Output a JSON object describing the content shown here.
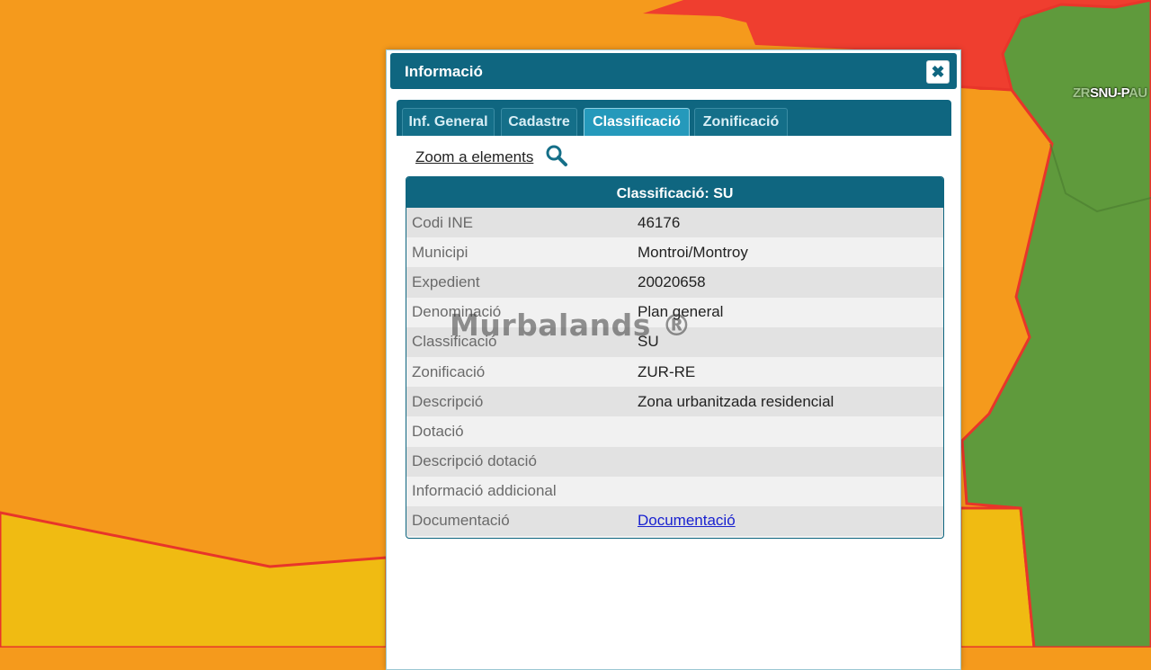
{
  "map": {
    "zone_label_dim": "ZR",
    "zone_label": "SNU-P",
    "zone_label_tail": "AU",
    "colors": {
      "orange": "#f59a1c",
      "red": "#ef3e2f",
      "yellow": "#f0bb12",
      "green": "#5f9a3c",
      "border": "#e8352a"
    }
  },
  "dialog": {
    "title": "Informació",
    "close_glyph": "✖",
    "tabs": [
      {
        "label": "Inf. General",
        "active": false
      },
      {
        "label": "Cadastre",
        "active": false
      },
      {
        "label": "Classificació",
        "active": true
      },
      {
        "label": "Zonificació",
        "active": false
      }
    ],
    "zoom_link": "Zoom a elements",
    "zoom_icon": "search-icon",
    "table": {
      "title_prefix": "Classificació: ",
      "title_value": "SU",
      "rows": [
        {
          "label": "Codi INE",
          "value": "46176"
        },
        {
          "label": "Municipi",
          "value": "Montroi/Montroy"
        },
        {
          "label": "Expedient",
          "value": "20020658"
        },
        {
          "label": "Denominació",
          "value": "Plan general"
        },
        {
          "label": "Classificació",
          "value": "SU"
        },
        {
          "label": "Zonificació",
          "value": "ZUR-RE"
        },
        {
          "label": "Descripció",
          "value": "Zona urbanitzada residencial"
        },
        {
          "label": "Dotació",
          "value": ""
        },
        {
          "label": "Descripció dotació",
          "value": ""
        },
        {
          "label": "Informació addicional",
          "value": ""
        },
        {
          "label": "Documentació",
          "value": "Documentació",
          "link": true
        }
      ]
    }
  },
  "watermark": "Murbalands ®"
}
